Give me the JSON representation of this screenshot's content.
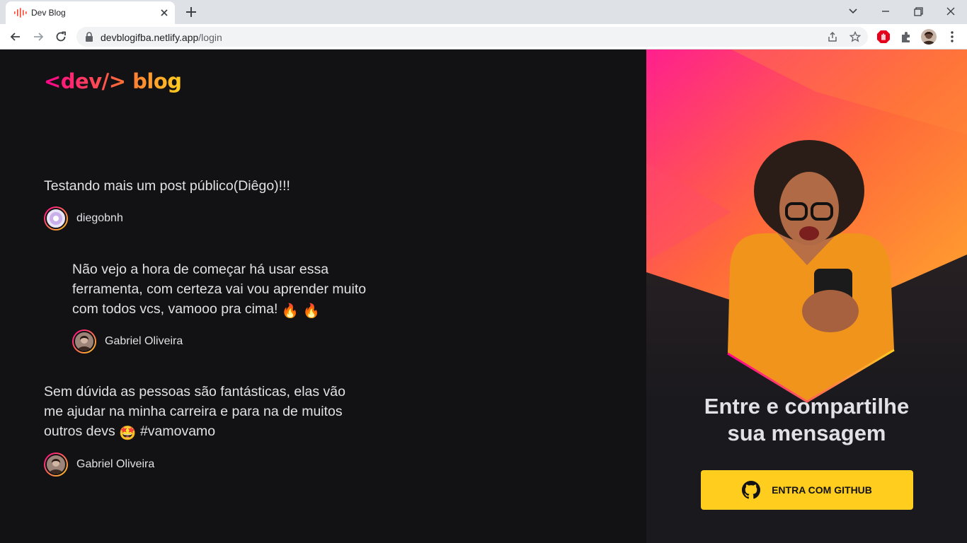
{
  "browser": {
    "tab_title": "Dev Blog",
    "url_domain": "devblogifba.netlify.app",
    "url_path": "/login"
  },
  "logo": {
    "text": "<dev/> blog"
  },
  "posts": [
    {
      "content": "Testando mais um post público(Diêgo)!!!",
      "author": "diegobnh"
    },
    {
      "content_lines": [
        "Não vejo a hora de começar há usar essa",
        "ferramenta, com certeza vai vou aprender muito",
        "com todos vcs, vamooo pra cima!"
      ],
      "emoji": "🔥 🔥",
      "author": "Gabriel Oliveira"
    },
    {
      "content_lines": [
        "Sem dúvida as pessoas são fantásticas, elas vão",
        "me ajudar na minha carreira e para na de muitos",
        "outros devs"
      ],
      "emoji": "🤩",
      "hashtag": "#vamovamo",
      "author": "Gabriel Oliveira"
    }
  ],
  "login": {
    "title_line1": "Entre e compartilhe",
    "title_line2": "sua mensagem",
    "github_button": "ENTRA COM GITHUB"
  },
  "colors": {
    "background": "#121214",
    "panel": "#1a191d",
    "accent_pink": "#ff008e",
    "accent_yellow": "#ffcd1e",
    "text": "#e1e1e6"
  }
}
